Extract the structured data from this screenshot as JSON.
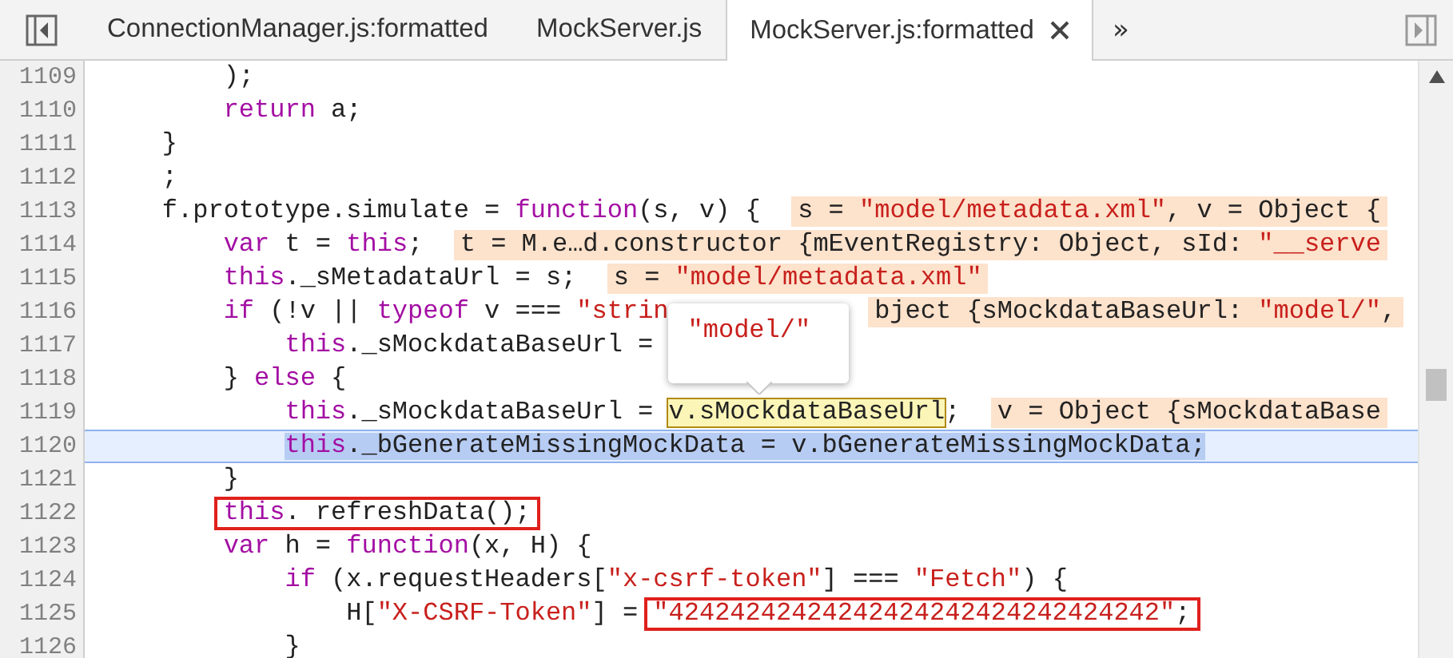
{
  "tabs": [
    {
      "label": "ConnectionManager.js:formatted",
      "selected": false,
      "closable": false
    },
    {
      "label": "MockServer.js",
      "selected": false,
      "closable": false
    },
    {
      "label": "MockServer.js:formatted",
      "selected": true,
      "closable": true
    }
  ],
  "more_tabs": "»",
  "lines": [
    {
      "number": "1109",
      "current": false,
      "parts": [
        {
          "kind": "code",
          "tokens": [
            {
              "kind": "plain",
              "text": "        );"
            }
          ]
        }
      ]
    },
    {
      "number": "1110",
      "current": false,
      "parts": [
        {
          "kind": "code",
          "tokens": [
            {
              "kind": "keyword",
              "text": "        return"
            },
            {
              "kind": "plain",
              "text": " a;"
            }
          ]
        }
      ]
    },
    {
      "number": "1111",
      "current": false,
      "parts": [
        {
          "kind": "code",
          "tokens": [
            {
              "kind": "plain",
              "text": "    }"
            }
          ]
        }
      ]
    },
    {
      "number": "1112",
      "current": false,
      "parts": [
        {
          "kind": "code",
          "tokens": [
            {
              "kind": "plain",
              "text": "    ;"
            }
          ]
        }
      ]
    },
    {
      "number": "1113",
      "current": false,
      "parts": [
        {
          "kind": "code",
          "tokens": [
            {
              "kind": "plain",
              "text": "    f.prototype.simulate = "
            },
            {
              "kind": "keyword",
              "text": "function"
            },
            {
              "kind": "plain",
              "text": "(s, v) {"
            }
          ]
        }
      ],
      "inline_value": {
        "cut_start": false,
        "tokens": [
          {
            "kind": "plain",
            "text": "s = "
          },
          {
            "kind": "string",
            "text": "\"model/metadata.xml\""
          },
          {
            "kind": "plain",
            "text": ", v = Object {"
          }
        ]
      }
    },
    {
      "number": "1114",
      "current": false,
      "parts": [
        {
          "kind": "code",
          "tokens": [
            {
              "kind": "keyword",
              "text": "        var"
            },
            {
              "kind": "plain",
              "text": " t = "
            },
            {
              "kind": "keyword",
              "text": "this"
            },
            {
              "kind": "plain",
              "text": ";"
            }
          ]
        }
      ],
      "inline_value": {
        "cut_start": false,
        "tokens": [
          {
            "kind": "plain",
            "text": "t = M.e…d.constructor {mEventRegistry: Object, sId: "
          },
          {
            "kind": "string",
            "text": "\"__serve"
          }
        ]
      }
    },
    {
      "number": "1115",
      "current": false,
      "parts": [
        {
          "kind": "code",
          "tokens": [
            {
              "kind": "keyword",
              "text": "        this"
            },
            {
              "kind": "plain",
              "text": "._sMetadataUrl = s;"
            }
          ]
        }
      ],
      "inline_value": {
        "cut_start": false,
        "tokens": [
          {
            "kind": "plain",
            "text": "s = "
          },
          {
            "kind": "string",
            "text": "\"model/metadata.xml\""
          }
        ]
      }
    },
    {
      "number": "1116",
      "current": false,
      "parts": [
        {
          "kind": "code",
          "tokens": [
            {
              "kind": "keyword",
              "text": "        if"
            },
            {
              "kind": "plain",
              "text": " (!v || "
            },
            {
              "kind": "keyword",
              "text": "typeof"
            },
            {
              "kind": "plain",
              "text": " v === "
            },
            {
              "kind": "string",
              "text": "\"strin"
            }
          ]
        }
      ],
      "inline_value": {
        "cut_start": true,
        "tokens": [
          {
            "kind": "plain",
            "text": "bject {sMockdataBaseUrl: "
          },
          {
            "kind": "string",
            "text": "\"model/\""
          },
          {
            "kind": "plain",
            "text": ","
          }
        ]
      }
    },
    {
      "number": "1117",
      "current": false,
      "parts": [
        {
          "kind": "code",
          "tokens": [
            {
              "kind": "keyword",
              "text": "            this"
            },
            {
              "kind": "plain",
              "text": "._sMockdataBaseUrl ="
            }
          ]
        }
      ]
    },
    {
      "number": "1118",
      "current": false,
      "parts": [
        {
          "kind": "code",
          "tokens": [
            {
              "kind": "plain",
              "text": "        } "
            },
            {
              "kind": "keyword",
              "text": "else"
            },
            {
              "kind": "plain",
              "text": " {"
            }
          ]
        }
      ]
    },
    {
      "number": "1119",
      "current": false,
      "parts": [
        {
          "kind": "code",
          "tokens": [
            {
              "kind": "keyword",
              "text": "            this"
            },
            {
              "kind": "plain",
              "text": "._sMockdataBaseUrl = "
            }
          ]
        },
        {
          "kind": "hover",
          "tokens": [
            {
              "kind": "plain",
              "text": "v.sMockdataBaseUrl"
            }
          ],
          "tooltip": [
            {
              "kind": "string",
              "text": "\"model/\""
            }
          ]
        },
        {
          "kind": "code",
          "tokens": [
            {
              "kind": "plain",
              "text": ";"
            }
          ]
        }
      ],
      "inline_value": {
        "cut_start": false,
        "tokens": [
          {
            "kind": "plain",
            "text": "v = Object {sMockdataBase"
          }
        ]
      }
    },
    {
      "number": "1120",
      "current": true,
      "parts": [
        {
          "kind": "selection",
          "tokens": [
            {
              "kind": "keyword",
              "text": "            this"
            },
            {
              "kind": "plain",
              "text": "._bGenerateMissingMockData = v.bGenerateMissingMockData;"
            }
          ]
        }
      ]
    },
    {
      "number": "1121",
      "current": false,
      "parts": [
        {
          "kind": "code",
          "tokens": [
            {
              "kind": "plain",
              "text": "        }"
            }
          ]
        }
      ]
    },
    {
      "number": "1122",
      "current": false,
      "parts": [
        {
          "kind": "red-box",
          "tokens": [
            {
              "kind": "keyword",
              "text": "        this"
            },
            {
              "kind": "plain",
              "text": ". refreshData();"
            }
          ]
        }
      ]
    },
    {
      "number": "1123",
      "current": false,
      "parts": [
        {
          "kind": "code",
          "tokens": [
            {
              "kind": "keyword",
              "text": "        var"
            },
            {
              "kind": "plain",
              "text": " h = "
            },
            {
              "kind": "keyword",
              "text": "function"
            },
            {
              "kind": "plain",
              "text": "(x, H) {"
            }
          ]
        }
      ]
    },
    {
      "number": "1124",
      "current": false,
      "parts": [
        {
          "kind": "code",
          "tokens": [
            {
              "kind": "keyword",
              "text": "            if"
            },
            {
              "kind": "plain",
              "text": " (x.requestHeaders["
            },
            {
              "kind": "string",
              "text": "\"x-csrf-token\""
            },
            {
              "kind": "plain",
              "text": "] === "
            },
            {
              "kind": "string",
              "text": "\"Fetch\""
            },
            {
              "kind": "plain",
              "text": ") {"
            }
          ]
        }
      ]
    },
    {
      "number": "1125",
      "current": false,
      "parts": [
        {
          "kind": "code",
          "tokens": [
            {
              "kind": "plain",
              "text": "                H["
            },
            {
              "kind": "string",
              "text": "\"X-CSRF-Token\""
            },
            {
              "kind": "plain",
              "text": "] = "
            }
          ]
        },
        {
          "kind": "red-box",
          "tokens": [
            {
              "kind": "string",
              "text": "\"42424242424242424242424242424242\""
            },
            {
              "kind": "plain",
              "text": ";"
            }
          ]
        }
      ]
    },
    {
      "number": "1126",
      "current": false,
      "parts": [
        {
          "kind": "code",
          "tokens": [
            {
              "kind": "plain",
              "text": "            }"
            }
          ]
        }
      ]
    }
  ]
}
